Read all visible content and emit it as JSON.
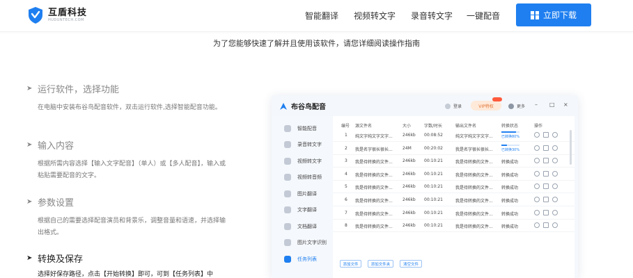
{
  "header": {
    "logo_name": "互盾科技",
    "logo_sub": "HUDUNTECH.COM",
    "nav": [
      "智能翻译",
      "视频转文字",
      "录音转文字",
      "一键配音"
    ],
    "download_label": "立即下载",
    "accent": "#1f7ff0"
  },
  "subtitle": "为了您能够快速了解并且使用该软件，请您详细阅读操作指南",
  "steps": [
    {
      "title": "运行软件，选择功能",
      "desc": "在电脑中安装布谷鸟配音软件，双击运行软件,选择智能配音功能。"
    },
    {
      "title": "输入内容",
      "desc": "根据所需内容选择【输入文字配音】（单人）或【多人配音】，输入或粘贴需要配音的文字。"
    },
    {
      "title": "参数设置",
      "desc": "根据自己的需要选择配音演员和背景乐，调整音量和语速，并选择输出格式。"
    },
    {
      "title": "转换及保存",
      "desc": "选择好保存路径，点击【开始转换】即可，可到【任务列表】中"
    }
  ],
  "app": {
    "title": "布谷鸟配音",
    "login": "登录",
    "vip": "VIP特权",
    "more": "更多",
    "controls": [
      "–",
      "□",
      "×"
    ],
    "sidebar": [
      "智能配音",
      "录音转文字",
      "视频转文字",
      "视频转音频",
      "图片翻译",
      "文字翻译",
      "文档翻译",
      "图片文字识别",
      "任务列表"
    ],
    "active_sidebar_index": 8,
    "columns": [
      "编号",
      "源文件名",
      "大小",
      "字数/时长",
      "输出文件名",
      "转换状态",
      "操作"
    ],
    "rows": [
      {
        "no": "1",
        "src": "纯文字纯文字文字...",
        "size": "246kb",
        "dur": "00:08:52",
        "out": "纯文字纯文字文字...",
        "status": "已转换80%",
        "progress": 0.8
      },
      {
        "no": "2",
        "src": "我是名字很长很长...",
        "size": "24M",
        "dur": "00:20:02",
        "out": "我是名字很长很长...",
        "status": "已转换30%",
        "progress": 0.3
      },
      {
        "no": "3",
        "src": "我是待转换的文件...",
        "size": "246kb",
        "dur": "00:10:21",
        "out": "我是待转换的文件...",
        "status": "转换成功",
        "progress": null
      },
      {
        "no": "4",
        "src": "我是待转换的文件...",
        "size": "246kb",
        "dur": "00:10:21",
        "out": "我是待转换的文件...",
        "status": "转换成功",
        "progress": null
      },
      {
        "no": "5",
        "src": "我是待转换的文件...",
        "size": "246kb",
        "dur": "00:10:21",
        "out": "我是待转换的文件...",
        "status": "转换成功",
        "progress": null
      },
      {
        "no": "6",
        "src": "我是待转换的文件...",
        "size": "246kb",
        "dur": "00:10:21",
        "out": "我是待转换的文件...",
        "status": "转换成功",
        "progress": null
      },
      {
        "no": "7",
        "src": "我是待转换的文件...",
        "size": "246kb",
        "dur": "00:10:21",
        "out": "我是待转换的文件...",
        "status": "转换成功",
        "progress": null
      },
      {
        "no": "8",
        "src": "我是待转换的文件...",
        "size": "246kb",
        "dur": "00:10:21",
        "out": "我是待转换的文件...",
        "status": "转换成功",
        "progress": null
      }
    ],
    "bottom_buttons": [
      "添加文件",
      "添加文件夹",
      "清空文件"
    ]
  }
}
